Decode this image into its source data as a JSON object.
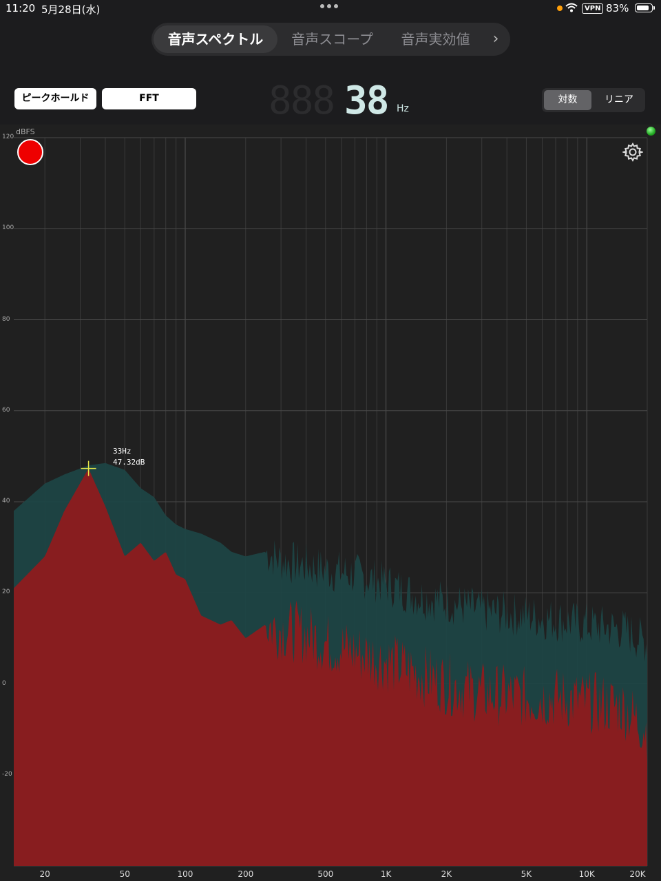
{
  "status_bar": {
    "time": "11:20",
    "date": "5月28日(水)",
    "vpn": "VPN",
    "battery": "83%"
  },
  "tabs": [
    {
      "label": "音声スペクトル",
      "selected": true
    },
    {
      "label": "音声スコープ",
      "selected": false
    },
    {
      "label": "音声実効値",
      "selected": false
    }
  ],
  "tabs_next_icon": "chevron-right-icon",
  "controls": {
    "peak_hold_label": "ピークホールド",
    "mode_label": "FFT",
    "frequency_ghost": "888",
    "frequency_value": "38",
    "frequency_unit": "Hz",
    "scale_options": [
      {
        "label": "対数",
        "selected": true
      },
      {
        "label": "リニア",
        "selected": false
      }
    ]
  },
  "plot": {
    "y_unit": "dBFS",
    "peak_readout": {
      "freq": "33Hz",
      "level": "47.32dB"
    },
    "record_color": "#ee0000",
    "led_color": "#33cc33"
  },
  "chart_data": {
    "type": "area",
    "x_scale": "log",
    "xlim": [
      14,
      20000
    ],
    "ylim": [
      -40,
      120
    ],
    "y_ticks": [
      "120",
      "100",
      "80",
      "60",
      "40",
      "20",
      "0",
      "-20"
    ],
    "x_ticks": [
      "20",
      "50",
      "100",
      "200",
      "500",
      "1K",
      "2K",
      "5K",
      "10K",
      "20K"
    ],
    "grid": true,
    "series": [
      {
        "color": "#1d4444",
        "x": [
          14,
          20,
          25,
          33,
          40,
          50,
          60,
          70,
          80,
          90,
          100,
          120,
          150,
          170,
          200,
          250,
          300,
          400,
          500,
          700,
          1000,
          1500,
          2000,
          3000,
          5000,
          7000,
          10000,
          15000,
          20000
        ],
        "y": [
          38,
          44,
          46,
          48,
          48.5,
          47,
          43,
          41,
          37,
          35,
          34,
          33,
          31,
          29,
          28,
          29,
          27,
          26,
          25,
          24,
          22,
          19,
          18,
          16,
          15,
          14,
          13,
          12,
          9
        ]
      },
      {
        "color": "#8c1c1e",
        "x": [
          14,
          20,
          25,
          33,
          40,
          50,
          60,
          70,
          80,
          90,
          100,
          120,
          150,
          170,
          200,
          250,
          300,
          400,
          500,
          700,
          1000,
          1500,
          2000,
          3000,
          5000,
          7000,
          10000,
          15000,
          20000
        ],
        "y": [
          21,
          28,
          38,
          47.32,
          39,
          28,
          31,
          27,
          29,
          24,
          23,
          15,
          13,
          14,
          10,
          13,
          12,
          11,
          9,
          7,
          5,
          2,
          0,
          -2,
          -3,
          -3,
          -4,
          -5,
          -10
        ]
      }
    ],
    "peak_marker": {
      "x": 33,
      "y": 47.32
    }
  }
}
